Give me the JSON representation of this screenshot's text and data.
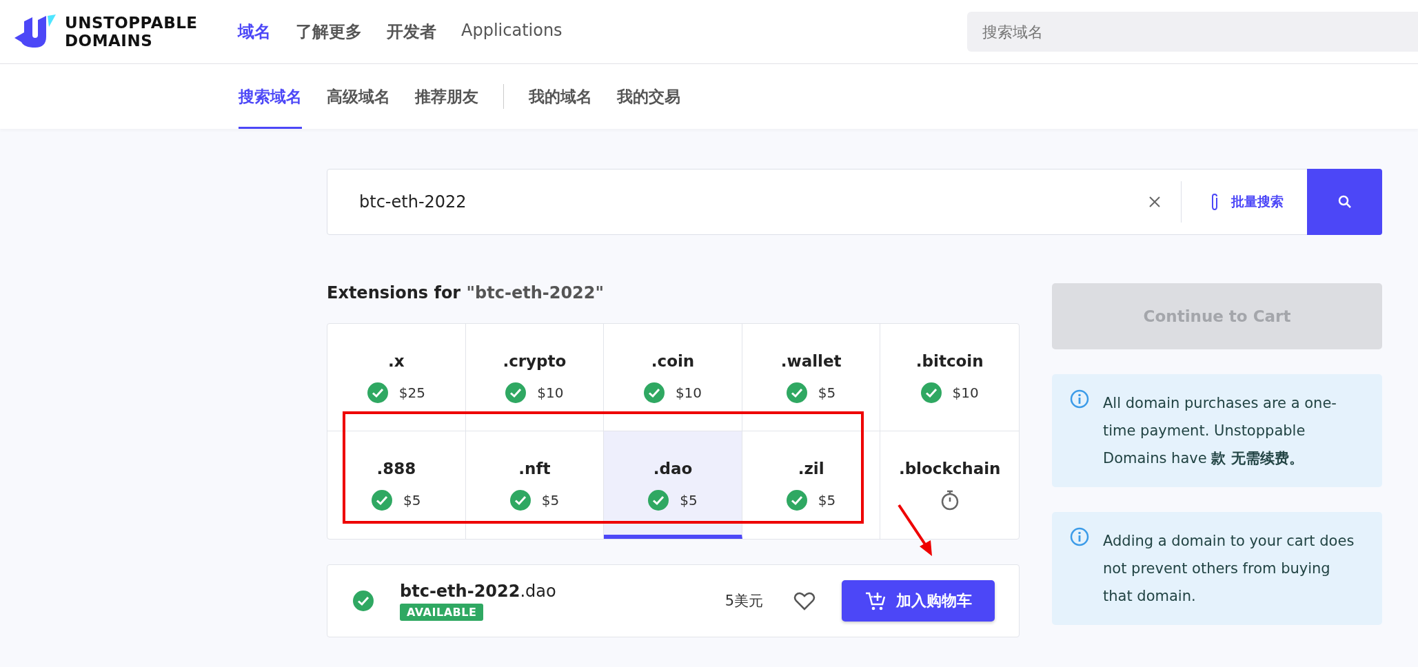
{
  "header": {
    "logo_text": [
      "UNSTOPPABLE",
      "DOMAINS"
    ],
    "nav": [
      {
        "label": "域名",
        "selected": true
      },
      {
        "label": "了解更多",
        "selected": false
      },
      {
        "label": "开发者",
        "selected": false
      },
      {
        "label": "Applications",
        "selected": false
      }
    ],
    "search": {
      "placeholder": "搜索域名"
    }
  },
  "subnav": {
    "groups": [
      [
        {
          "label": "搜索域名",
          "selected": true
        },
        {
          "label": "高级域名",
          "selected": false
        },
        {
          "label": "推荐朋友",
          "selected": false
        }
      ],
      [
        {
          "label": "我的域名",
          "selected": false
        },
        {
          "label": "我的交易",
          "selected": false
        }
      ]
    ]
  },
  "domain_search": {
    "value": "btc-eth-2022",
    "bulk_label": "批量搜索"
  },
  "extensions": {
    "title": "Extensions for ",
    "query": "\"btc-eth-2022\"",
    "items": [
      {
        "tld": ".x",
        "kind": "available",
        "price": "$25",
        "selected": false
      },
      {
        "tld": ".crypto",
        "kind": "available",
        "price": "$10",
        "selected": false
      },
      {
        "tld": ".coin",
        "kind": "available",
        "price": "$10",
        "selected": false
      },
      {
        "tld": ".wallet",
        "kind": "available",
        "price": "$5",
        "selected": false
      },
      {
        "tld": ".bitcoin",
        "kind": "available",
        "price": "$10",
        "selected": false
      },
      {
        "tld": ".888",
        "kind": "available",
        "price": "$5",
        "selected": false
      },
      {
        "tld": ".nft",
        "kind": "available",
        "price": "$5",
        "selected": false
      },
      {
        "tld": ".dao",
        "kind": "available",
        "price": "$5",
        "selected": true
      },
      {
        "tld": ".zil",
        "kind": "available",
        "price": "$5",
        "selected": false
      },
      {
        "tld": ".blockchain",
        "kind": "pending",
        "selected": false
      }
    ]
  },
  "result": {
    "domain": "**btc-eth-2022**.dao",
    "badge": "AVAILABLE",
    "price": "5美元",
    "favorite": false,
    "button": "加入购物车"
  },
  "sidebar": {
    "continue_button": {
      "label": "Continue to Cart",
      "disabled": true
    },
    "notes": [
      "All domain purchases are a one-time payment. Unstoppable Domains have **款 无需续费。**",
      "Adding a domain to your cart does not prevent others from buying that domain."
    ]
  },
  "annotations": {
    "highlight_box": true,
    "arrow": true
  }
}
